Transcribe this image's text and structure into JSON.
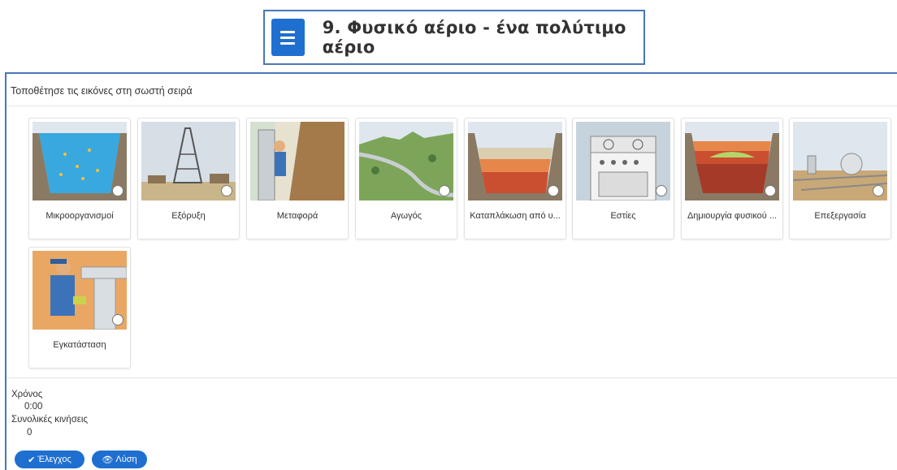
{
  "header": {
    "title": "9. Φυσικό αέριο - ένα πολύτιμο αέριο"
  },
  "instruction": "Τοποθέτησε τις εικόνες στη σωστή σειρά",
  "cards": [
    {
      "label": "Μικροοργανισμοί"
    },
    {
      "label": "Εξόρυξη"
    },
    {
      "label": "Μεταφορά"
    },
    {
      "label": "Αγωγός"
    },
    {
      "label": "Καταπλάκωση από υ..."
    },
    {
      "label": "Εστίες"
    },
    {
      "label": "Δημιουργία φυσικού ..."
    },
    {
      "label": "Επεξεργασία"
    },
    {
      "label": "Εγκατάσταση"
    }
  ],
  "stats": {
    "time_label": "Χρόνος",
    "time_value": "0:00",
    "moves_label": "Συνολικές κινήσεις",
    "moves_value": "0"
  },
  "buttons": {
    "check_label": "Έλεγχος",
    "check_icon": "check-icon",
    "solution_label": "Λύση",
    "solution_icon": "eye-icon"
  },
  "colors": {
    "accent": "#1f6fd0",
    "frame": "#4a76b8"
  }
}
